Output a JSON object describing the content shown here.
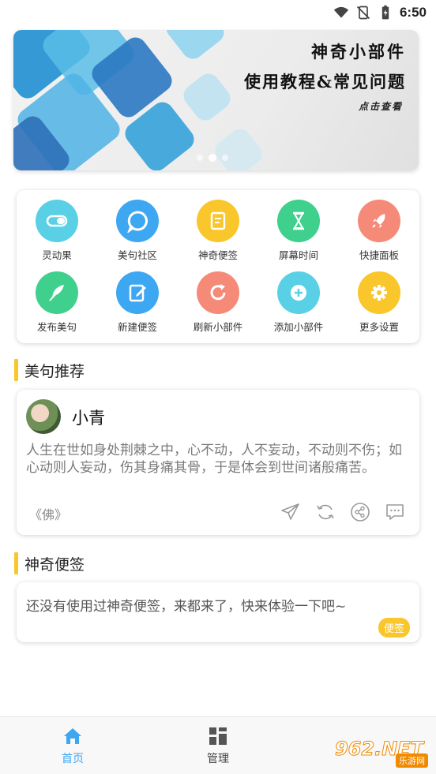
{
  "status_bar": {
    "time": "6:50"
  },
  "banner": {
    "line1": "神奇小部件",
    "line2": "使用教程&常见问题",
    "line3": "点击查看",
    "dots": 3,
    "active_dot": 2
  },
  "grid": {
    "items": [
      {
        "label": "灵动果",
        "icon": "toggle-icon",
        "color": "#5ad0e6"
      },
      {
        "label": "美句社区",
        "icon": "chat-bubble-icon",
        "color": "#3ea7f2"
      },
      {
        "label": "神奇便签",
        "icon": "note-icon",
        "color": "#f9c62b"
      },
      {
        "label": "屏幕时间",
        "icon": "hourglass-icon",
        "color": "#3fd08d"
      },
      {
        "label": "快捷面板",
        "icon": "rocket-icon",
        "color": "#f58a78"
      },
      {
        "label": "发布美句",
        "icon": "feather-icon",
        "color": "#3fd08d"
      },
      {
        "label": "新建便签",
        "icon": "edit-note-icon",
        "color": "#3ea7f2"
      },
      {
        "label": "刷新小部件",
        "icon": "refresh-icon",
        "color": "#f58a78"
      },
      {
        "label": "添加小部件",
        "icon": "plus-icon",
        "color": "#5ad0e6"
      },
      {
        "label": "更多设置",
        "icon": "gear-icon",
        "color": "#f9c62b"
      }
    ]
  },
  "quotes_section": {
    "title": "美句推荐",
    "card": {
      "username": "小青",
      "text": "人生在世如身处荆棘之中，心不动，人不妄动，不动则不伤；如心动则人妄动，伤其身痛其骨，于是体会到世间诸般痛苦。",
      "source": "《佛》"
    }
  },
  "notes_section": {
    "title": "神奇便签",
    "card": {
      "text": "还没有使用过神奇便签，来都来了，快来体验一下吧~",
      "badge": "便签"
    }
  },
  "bottom_nav": {
    "items": [
      {
        "label": "首页",
        "active": true
      },
      {
        "label": "管理",
        "active": false
      }
    ]
  },
  "watermark": {
    "text": "962.NET",
    "sub": "乐游网"
  },
  "colors": {
    "accent": "#3ea7f2",
    "section_bar": "#f9c62b",
    "badge": "#f9c62b"
  }
}
